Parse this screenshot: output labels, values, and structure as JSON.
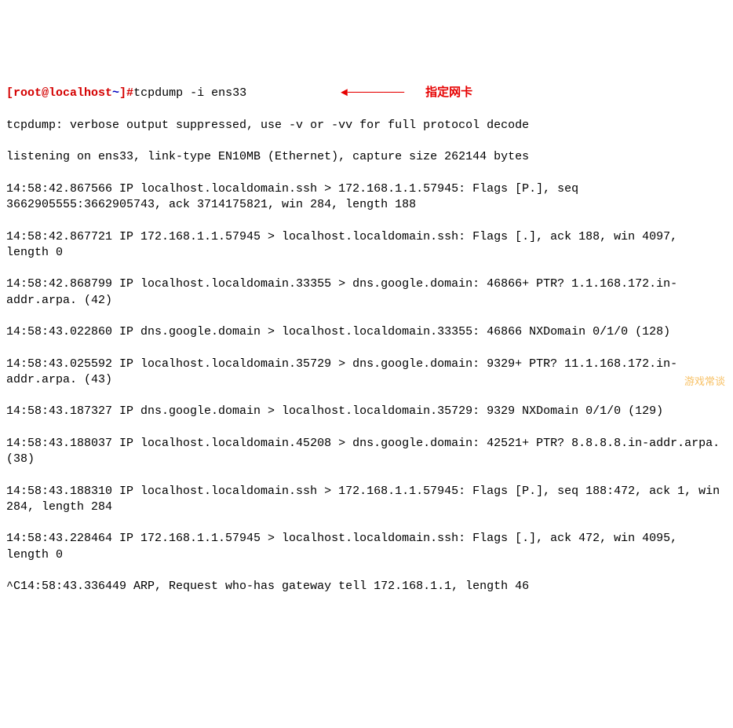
{
  "prompt": {
    "user_host": "[root@localhost ",
    "path": "~",
    "symbol": "]#",
    "command": "tcpdump -i ens33"
  },
  "annotation": {
    "arrow": "◄────────",
    "label": "指定网卡"
  },
  "output": [
    "tcpdump: verbose output suppressed, use -v or -vv for full protocol decode",
    "listening on ens33, link-type EN10MB (Ethernet), capture size 262144 bytes",
    "14:58:42.867566 IP localhost.localdomain.ssh > 172.168.1.1.57945: Flags [P.], seq 3662905555:3662905743, ack 3714175821, win 284, length 188",
    "14:58:42.867721 IP 172.168.1.1.57945 > localhost.localdomain.ssh: Flags [.], ack 188, win 4097, length 0",
    "14:58:42.868799 IP localhost.localdomain.33355 > dns.google.domain: 46866+ PTR? 1.1.168.172.in-addr.arpa. (42)",
    "14:58:43.022860 IP dns.google.domain > localhost.localdomain.33355: 46866 NXDomain 0/1/0 (128)",
    "14:58:43.025592 IP localhost.localdomain.35729 > dns.google.domain: 9329+ PTR? 11.1.168.172.in-addr.arpa. (43)",
    "14:58:43.187327 IP dns.google.domain > localhost.localdomain.35729: 9329 NXDomain 0/1/0 (129)",
    "14:58:43.188037 IP localhost.localdomain.45208 > dns.google.domain: 42521+ PTR? 8.8.8.8.in-addr.arpa. (38)",
    "14:58:43.188310 IP localhost.localdomain.ssh > 172.168.1.1.57945: Flags [P.], seq 188:472, ack 1, win 284, length 284",
    "14:58:43.228464 IP 172.168.1.1.57945 > localhost.localdomain.ssh: Flags [.], ack 472, win 4095, length 0",
    "^C14:58:43.336449 ARP, Request who-has gateway tell 172.168.1.1, length 46"
  ],
  "watermark": "游戏常谈"
}
